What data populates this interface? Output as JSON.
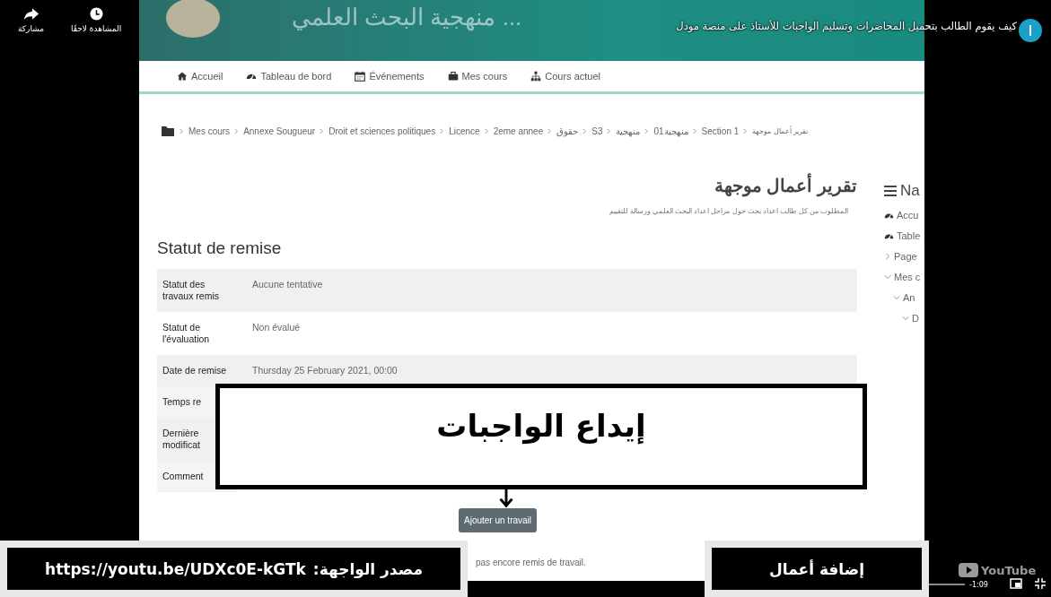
{
  "player": {
    "share_label": "مشاركة",
    "watch_later_label": "المشاهدة لاحقًا",
    "video_title": "كيف يقوم الطالب بتحميل المحاضرات وتسليم الواجبات للأستاذ على منصة مودل",
    "logo_text": "YouTube",
    "time_remaining": "-1:09"
  },
  "site": {
    "title": "... منهجية البحث العلمي"
  },
  "nav": [
    {
      "label": "Accueil"
    },
    {
      "label": "Tableau de bord"
    },
    {
      "label": "Événements"
    },
    {
      "label": "Mes cours"
    },
    {
      "label": "Cours actuel"
    }
  ],
  "breadcrumb": [
    "Mes cours",
    "Annexe Sougueur",
    "Droit et sciences politiques",
    "Licence",
    "2eme annee",
    "حقوق",
    "S3",
    "منهجية",
    "01منهجية",
    "Section 1",
    "تقرير أعمال موجهة"
  ],
  "page": {
    "title": "تقرير أعمال موجهة",
    "description": "المطلوب من كل طالب اعداد بحث حول مراحل اعداد البحث العلمي ورسالة للتقييم",
    "section_heading": "Statut de remise",
    "status_rows": [
      {
        "label": "Statut des travaux remis",
        "value": "Aucune tentative"
      },
      {
        "label": "Statut de l'évaluation",
        "value": "Non évalué"
      },
      {
        "label": "Date de remise",
        "value": "Thursday 25 February 2021, 00:00"
      },
      {
        "label": "Temps re",
        "value": ""
      },
      {
        "label": "Dernière modificat",
        "value": ""
      },
      {
        "label": "Comment",
        "value": ""
      }
    ],
    "add_button": "Ajouter un travail",
    "footer_note": "pas encore remis de travail."
  },
  "sidebar": {
    "heading": "Na",
    "items": [
      {
        "kind": "link",
        "label": "Accu"
      },
      {
        "kind": "link",
        "label": "Table"
      },
      {
        "kind": "node",
        "label": "Page",
        "expanded": false
      },
      {
        "kind": "node",
        "label": "Mes c",
        "expanded": true,
        "children": [
          {
            "kind": "node",
            "label": "An",
            "expanded": true,
            "children": [
              {
                "kind": "node",
                "label": "D",
                "expanded": true
              }
            ]
          }
        ]
      }
    ]
  },
  "overlays": {
    "annotation": "إيداع الواجبات",
    "source_label": "مصدر الواجهة:",
    "source_url": "https://youtu.be/UDXc0E-kGTk",
    "action_caption": "إضافة أعمال"
  }
}
